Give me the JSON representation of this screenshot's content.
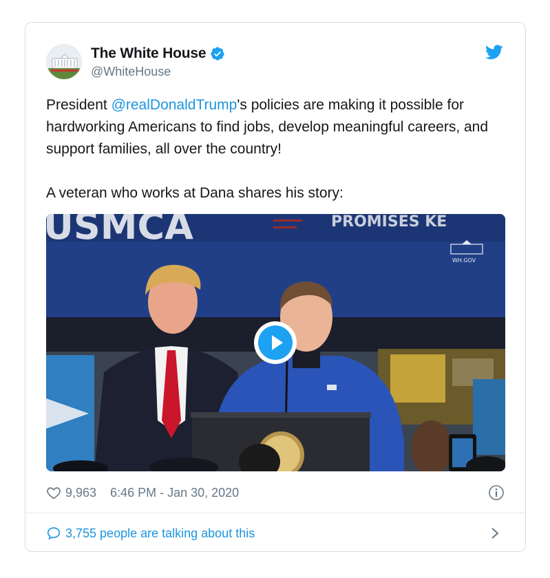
{
  "author": {
    "display_name": "The White House",
    "handle": "@WhiteHouse"
  },
  "tweet": {
    "prefix": "President ",
    "mention": "@realDonaldTrump",
    "suffix": "'s policies are making it possible for hardworking Americans to find jobs, develop meaningful careers, and support families, all over the country!",
    "line2": "A veteran who works at Dana shares his story:"
  },
  "media": {
    "banner_left": "USMCA",
    "banner_right": "PROMISES KE",
    "watermark": "WH.GOV"
  },
  "meta": {
    "likes": "9,963",
    "timestamp": "6:46 PM - Jan 30, 2020"
  },
  "conversation": {
    "label": "3,755 people are talking about this"
  },
  "icons": {
    "twitter": "twitter-bird-icon",
    "verified": "verified-badge-icon",
    "heart": "heart-icon",
    "info": "info-icon",
    "reply": "speech-bubble-icon",
    "chevron": "chevron-right-icon",
    "play": "play-icon"
  },
  "colors": {
    "accent": "#1da1f2",
    "link": "#1b95e0",
    "secondary_text": "#657786",
    "border": "#e1e8ed"
  }
}
